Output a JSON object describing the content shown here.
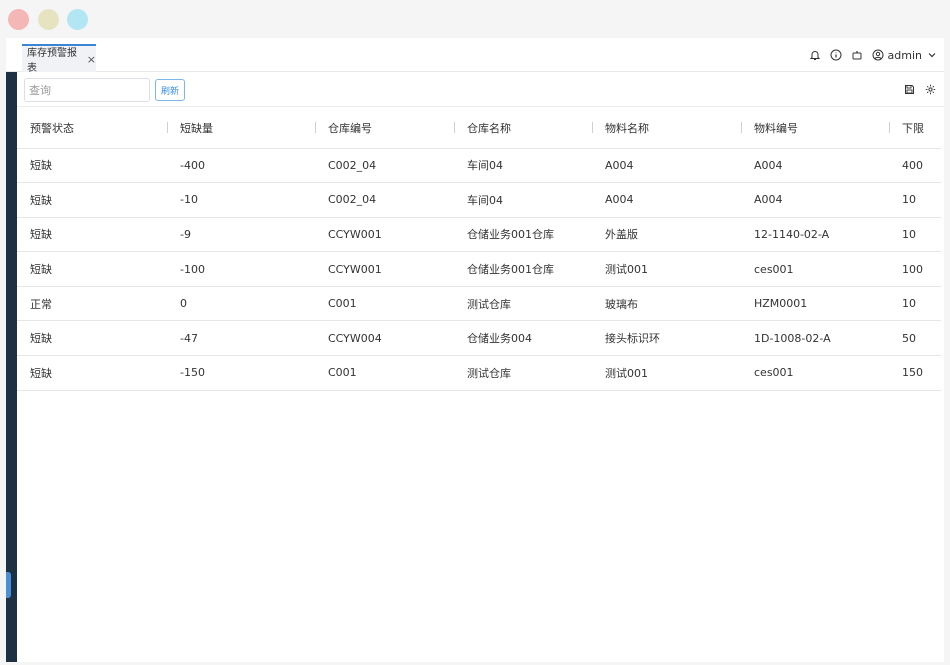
{
  "tab": {
    "label": "库存预警报表",
    "close": "×"
  },
  "header": {
    "user": "admin"
  },
  "toolbar": {
    "search_placeholder": "查询",
    "refresh_label": "刷新"
  },
  "table": {
    "columns": [
      "预警状态",
      "短缺量",
      "仓库编号",
      "仓库名称",
      "物料名称",
      "物料编号",
      "下限"
    ],
    "rows": [
      [
        "短缺",
        "-400",
        "C002_04",
        "车间04",
        "A004",
        "A004",
        "400"
      ],
      [
        "短缺",
        "-10",
        "C002_04",
        "车间04",
        "A004",
        "A004",
        "10"
      ],
      [
        "短缺",
        "-9",
        "CCYW001",
        "仓储业务001仓库",
        "外盖版",
        "12-1140-02-A",
        "10"
      ],
      [
        "短缺",
        "-100",
        "CCYW001",
        "仓储业务001仓库",
        "测试001",
        "ces001",
        "100"
      ],
      [
        "正常",
        "0",
        "C001",
        "测试仓库",
        "玻璃布",
        "HZM0001",
        "10"
      ],
      [
        "短缺",
        "-47",
        "CCYW004",
        "仓储业务004",
        "接头标识环",
        "1D-1008-02-A",
        "50"
      ],
      [
        "短缺",
        "-150",
        "C001",
        "测试仓库",
        "测试001",
        "ces001",
        "150"
      ]
    ]
  }
}
